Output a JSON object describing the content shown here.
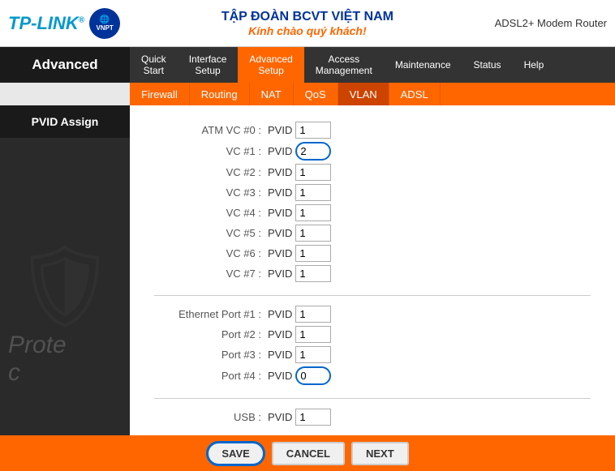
{
  "header": {
    "logo": "TP-LINK",
    "vnpt_label": "VNPT",
    "title_vn": "TẬP ĐOÀN BCVT VIỆT NAM",
    "subtitle_vn": "Kính chào quý khách!",
    "device": "ADSL2+ Modem Router"
  },
  "nav": {
    "sidebar_label": "Advanced",
    "items": [
      {
        "label": "Quick Start",
        "active": false
      },
      {
        "label": "Interface Setup",
        "active": false
      },
      {
        "label": "Advanced Setup",
        "active": true
      },
      {
        "label": "Access Management",
        "active": false
      },
      {
        "label": "Maintenance",
        "active": false
      },
      {
        "label": "Status",
        "active": false
      },
      {
        "label": "Help",
        "active": false
      }
    ],
    "sub_items": [
      {
        "label": "Firewall",
        "active": false
      },
      {
        "label": "Routing",
        "active": false
      },
      {
        "label": "NAT",
        "active": false
      },
      {
        "label": "QoS",
        "active": false
      },
      {
        "label": "VLAN",
        "active": true
      },
      {
        "label": "ADSL",
        "active": false
      }
    ]
  },
  "sidebar": {
    "label": "PVID Assign"
  },
  "form": {
    "atm_label": "ATM VC #0 :",
    "vc1_label": "VC #1 :",
    "vc2_label": "VC #2 :",
    "vc3_label": "VC #3 :",
    "vc4_label": "VC #4 :",
    "vc5_label": "VC #5 :",
    "vc6_label": "VC #6 :",
    "vc7_label": "VC #7 :",
    "eth1_label": "Ethernet Port #1 :",
    "port2_label": "Port #2 :",
    "port3_label": "Port #3 :",
    "port4_label": "Port #4 :",
    "usb_label": "USB :",
    "pvid_text": "PVID",
    "atm_val": "1",
    "vc1_val": "2",
    "vc2_val": "1",
    "vc3_val": "1",
    "vc4_val": "1",
    "vc5_val": "1",
    "vc6_val": "1",
    "vc7_val": "1",
    "eth1_val": "1",
    "port2_val": "1",
    "port3_val": "1",
    "port4_val": "0",
    "usb_val": "1"
  },
  "footer": {
    "save_label": "SAVE",
    "cancel_label": "CANCEL",
    "next_label": "NEXT"
  }
}
